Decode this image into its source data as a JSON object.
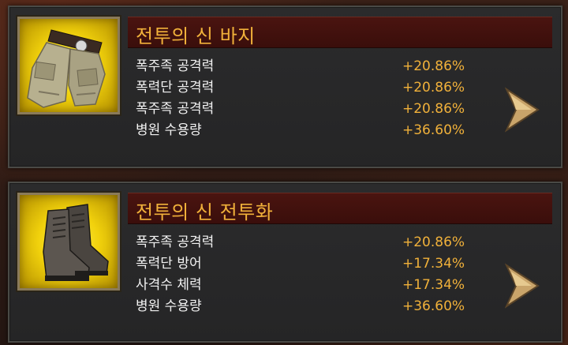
{
  "items": [
    {
      "name": "전투의 신 바지",
      "icon": "pants-icon",
      "stats": [
        {
          "name": "폭주족 공격력",
          "value": "+20.86%"
        },
        {
          "name": "폭력단 공격력",
          "value": "+20.86%"
        },
        {
          "name": "폭주족 공격력",
          "value": "+20.86%"
        },
        {
          "name": "병원 수용량",
          "value": "+36.60%"
        }
      ]
    },
    {
      "name": "전투의 신 전투화",
      "icon": "boots-icon",
      "stats": [
        {
          "name": "폭주족 공격력",
          "value": "+20.86%"
        },
        {
          "name": "폭력단 방어",
          "value": "+17.34%"
        },
        {
          "name": "사격수 체력",
          "value": "+17.34%"
        },
        {
          "name": "병원 수용량",
          "value": "+36.60%"
        }
      ]
    }
  ],
  "colors": {
    "title": "#f1b13a",
    "value": "#f1b13a",
    "label": "#f2f2f2",
    "title_bar": "#4a1410",
    "icon_bg": "#f1d10c"
  }
}
